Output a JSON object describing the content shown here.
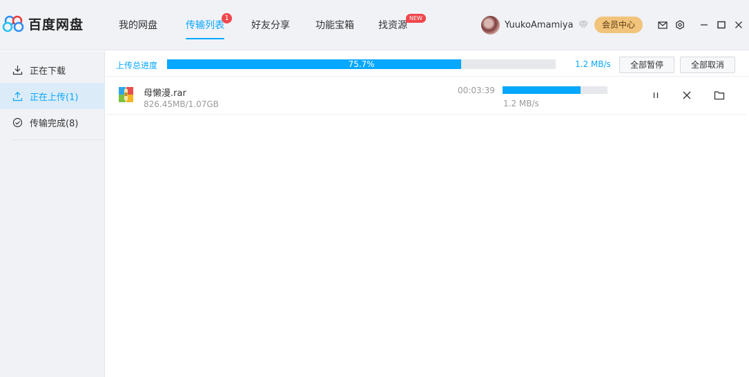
{
  "app": {
    "title": "百度网盘"
  },
  "nav": {
    "items": [
      {
        "label": "我的网盘"
      },
      {
        "label": "传输列表",
        "badge": "1"
      },
      {
        "label": "好友分享"
      },
      {
        "label": "功能宝箱"
      },
      {
        "label": "找资源",
        "badge": "NEW"
      }
    ],
    "active": "传输列表"
  },
  "user": {
    "name": "YuukoAmamiya",
    "vip_button": "会员中心"
  },
  "toolbar_icons": [
    "mail-icon",
    "settings-icon",
    "minimize-icon",
    "maximize-icon",
    "close-icon"
  ],
  "sidebar": {
    "items": [
      {
        "label": "正在下载",
        "icon": "download-icon"
      },
      {
        "label": "正在上传(1)",
        "icon": "upload-icon"
      },
      {
        "label": "传输完成(8)",
        "icon": "check-circle-icon"
      }
    ],
    "active_index": 1
  },
  "summary": {
    "label": "上传总进度",
    "percent_text": "75.7%",
    "progress": 0.757,
    "speed": "1.2 MB/s",
    "pause_all": "全部暂停",
    "cancel_all": "全部取消"
  },
  "transfers": [
    {
      "name": "母懒漫.rar",
      "size": "826.45MB/1.07GB",
      "remaining": "00:03:39",
      "progress": 0.743,
      "speed": "1.2 MB/s"
    }
  ],
  "colors": {
    "accent": "#06a7ff",
    "badge": "#f0464b",
    "vip": "#f1c37b",
    "sidebar_bg": "#f1f2f6",
    "active_bg": "#dcebf8"
  }
}
